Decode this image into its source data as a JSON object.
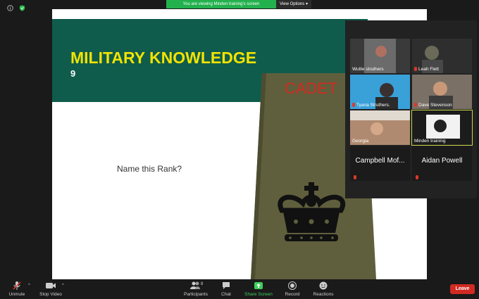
{
  "banner": {
    "message": "You are viewing Minden training's screen",
    "view_options": "View Options"
  },
  "slide": {
    "title": "MILITARY KNOWLEDGE",
    "number": "9",
    "question": "Name this Rank?",
    "rank_label": "CADET"
  },
  "participants": [
    {
      "name": "Wullie struthers",
      "muted": false
    },
    {
      "name": "Leah Flett",
      "muted": true
    },
    {
      "name": "Tyana Struthers.",
      "muted": true
    },
    {
      "name": "Dave Stevenson",
      "muted": true
    },
    {
      "name": "Georgia",
      "muted": false
    },
    {
      "name": "Minden training",
      "muted": false,
      "active_speaker": true
    },
    {
      "name": "Campbell Mof...",
      "muted": true
    },
    {
      "name": "Aidan Powell",
      "muted": true
    }
  ],
  "toolbar": {
    "unmute": "Unmute",
    "stop_video": "Stop Video",
    "participants": "Participants",
    "participants_count": "8",
    "chat": "Chat",
    "share_screen": "Share Screen",
    "record": "Record",
    "reactions": "Reactions",
    "leave": "Leave"
  },
  "colors": {
    "slide_header": "#0f5c4c",
    "slide_title": "#f2e300",
    "rank_slide": "#5f5f3d",
    "cadet_text": "#d42a20",
    "share_green": "#3ecf5e",
    "leave_red": "#d12a22"
  }
}
